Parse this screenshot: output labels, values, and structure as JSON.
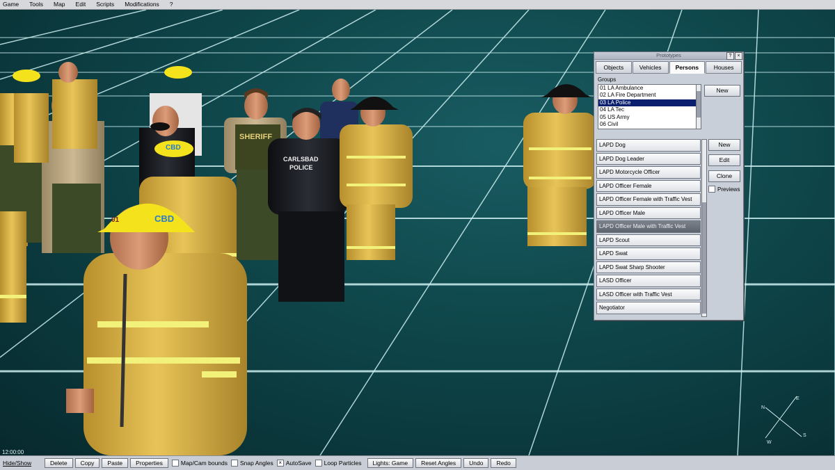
{
  "menu": [
    "Game",
    "Tools",
    "Map",
    "Edit",
    "Scripts",
    "Modifications",
    "?"
  ],
  "viewport": {
    "clock": "12:00:00",
    "compass": {
      "n": "N",
      "e": "E",
      "s": "S",
      "w": "W"
    },
    "uniform_text": {
      "sheriff": "SHERIFF",
      "carlsbad": "CARLSBAD",
      "police": "POLICE",
      "cbd": "CBD",
      "helmet_number": "01"
    }
  },
  "panel": {
    "title": "Prototypes",
    "help_label": "?",
    "close_label": "×",
    "tabs": [
      {
        "label": "Objects"
      },
      {
        "label": "Vehicles"
      },
      {
        "label": "Persons"
      },
      {
        "label": "Houses"
      }
    ],
    "active_tab": "Persons",
    "groups_label": "Groups",
    "groups": [
      "01 LA Ambulance",
      "02 LA Fire Department",
      "03 LA Police",
      "04 LA Tec",
      "05 US Army",
      "06 Civil"
    ],
    "selected_group": "03 LA Police",
    "group_new_label": "New",
    "items": [
      "LAPD Dog",
      "LAPD Dog Leader",
      "LAPD Motorcycle Officer",
      "LAPD Officer Female",
      "LAPD Officer Female with Traffic Vest",
      "LAPD Officer Male",
      "LAPD Officer Male with Traffic Vest",
      "LAPD Scout",
      "LAPD Swat",
      "LAPD Swat Sharp Shooter",
      "LASD Officer",
      "LASD Officer with Traffic Vest",
      "Negotiator"
    ],
    "selected_item": "LAPD Officer Male with Traffic Vest",
    "buttons": {
      "new": "New",
      "edit": "Edit",
      "clone": "Clone"
    },
    "previews_label": "Previews",
    "previews_checked": false
  },
  "toolbar": {
    "hide_show": "Hide/Show",
    "delete": "Delete",
    "copy": "Copy",
    "paste": "Paste",
    "properties": "Properties",
    "map_cam_bounds": "Map/Cam bounds",
    "snap_angles": "Snap Angles",
    "autosave": "AutoSave",
    "loop_particles": "Loop Particles",
    "lights": "Lights: Game",
    "reset_angles": "Reset Angles",
    "undo": "Undo",
    "redo": "Redo",
    "map_cam_bounds_checked": false,
    "snap_angles_checked": false,
    "autosave_checked": true,
    "loop_particles_checked": false
  },
  "colors": {
    "ground": "#0e4549",
    "grid": "#cdeff0",
    "firefighter": "#e1b94e",
    "reflective_stripe": "#f2f27a",
    "sheriff_shirt": "#c9b48c",
    "sheriff_pants": "#3d4a28",
    "police_uniform": "#1b1d22",
    "helmet_yellow": "#f4e21c",
    "selection_blue": "#0a1f6e"
  }
}
